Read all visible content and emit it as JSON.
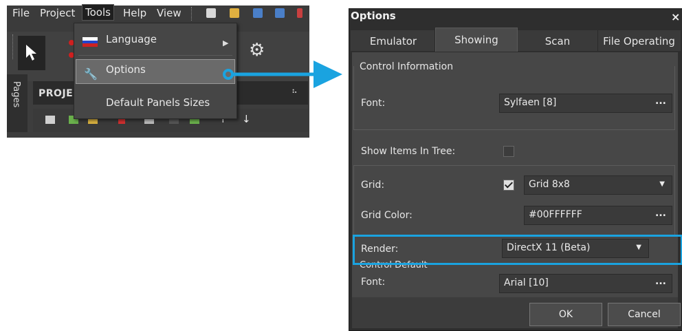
{
  "menubar": {
    "items": [
      "File",
      "Project",
      "Tools",
      "Help",
      "View"
    ],
    "active": "Tools"
  },
  "dropdown": {
    "language": "Language",
    "options": "Options",
    "default_panels": "Default Panels Sizes"
  },
  "side_tab": "Pages",
  "project_header": "PROJEC",
  "colors": {
    "accent": "#1aa3e0",
    "dialog_bg": "#474747",
    "menu_bg": "#3d3d3d"
  },
  "dialog": {
    "title": "Options",
    "close": "×",
    "tabs": [
      "Emulator",
      "Showing",
      "Scan",
      "File Operating"
    ],
    "active_tab": "Showing",
    "control_info": {
      "section": "Control Information",
      "font_label": "Font:",
      "font_value": "Sylfaen [8]"
    },
    "show_items_label": "Show Items In Tree:",
    "show_items_checked": false,
    "grid_label": "Grid:",
    "grid_checked": true,
    "grid_value": "Grid 8x8",
    "grid_color_label": "Grid Color:",
    "grid_color_value": "#00FFFFFF",
    "render_label": "Render:",
    "render_value": "DirectX 11 (Beta)",
    "control_default": {
      "section": "Control Default",
      "font_label": "Font:",
      "font_value": "Arial [10]"
    },
    "ellipsis": "...",
    "ok": "OK",
    "cancel": "Cancel"
  }
}
